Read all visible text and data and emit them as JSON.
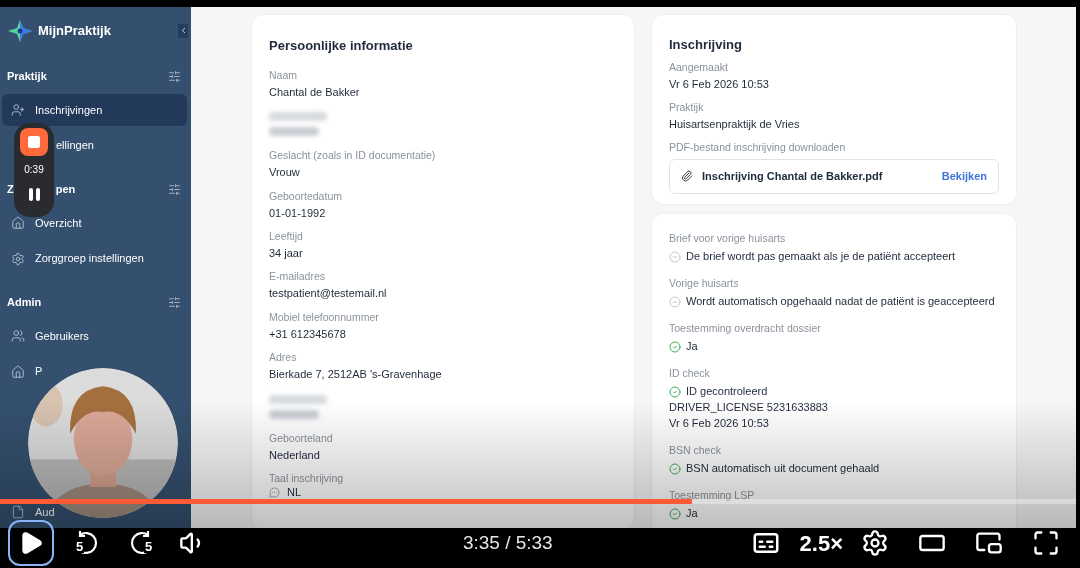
{
  "sidebar": {
    "brand": "MijnPraktijk",
    "sections": [
      {
        "title": "Praktijk",
        "items": [
          {
            "label": "Inschrijvingen",
            "selected": true
          },
          {
            "label": "ellingen",
            "selected": false
          }
        ]
      },
      {
        "title": "Z",
        "title_tail": "pen",
        "items": [
          {
            "label": "Overzicht",
            "selected": false
          },
          {
            "label": "Zorggroep instellingen",
            "selected": false
          }
        ]
      },
      {
        "title": "Admin",
        "items": [
          {
            "label": "Gebruikers",
            "selected": false
          },
          {
            "label": "P",
            "selected": false
          },
          {
            "label": "Aud",
            "selected": false
          }
        ]
      }
    ]
  },
  "recorder": {
    "time": "0:39"
  },
  "personal": {
    "title": "Persoonlijke informatie",
    "fields": [
      {
        "kind": "text",
        "label": "Naam",
        "value": "Chantal de Bakker"
      },
      {
        "kind": "redacted"
      },
      {
        "kind": "text",
        "label": "Geslacht (zoals in ID documentatie)",
        "value": "Vrouw"
      },
      {
        "kind": "text",
        "label": "Geboortedatum",
        "value": "01-01-1992"
      },
      {
        "kind": "text",
        "label": "Leeftijd",
        "value": "34 jaar"
      },
      {
        "kind": "text",
        "label": "E-mailadres",
        "value": "testpatient@testemail.nl"
      },
      {
        "kind": "text",
        "label": "Mobiel telefoonnummer",
        "value": "+31 612345678"
      },
      {
        "kind": "text",
        "label": "Adres",
        "value": "Bierkade 7, 2512AB 's-Gravenhage"
      },
      {
        "kind": "redacted"
      },
      {
        "kind": "text",
        "label": "Geboorteland",
        "value": "Nederland"
      },
      {
        "kind": "language",
        "label": "Taal inschrijving",
        "value": "NL"
      }
    ]
  },
  "registration": {
    "title": "Inschrijving",
    "fields": [
      {
        "label": "Aangemaakt",
        "value": "Vr 6 Feb 2026 10:53"
      },
      {
        "label": "Praktijk",
        "value": "Huisartsenpraktijk de Vries"
      }
    ],
    "pdf": {
      "label": "PDF-bestand inschrijving downloaden",
      "file": "Inschrijving Chantal de Bakker.pdf",
      "action": "Bekijken"
    }
  },
  "checks": [
    {
      "label": "Brief voor vorige huisarts",
      "done": false,
      "lines": [
        "De brief wordt pas gemaakt als je de patiënt accepteert"
      ]
    },
    {
      "label": "Vorige huisarts",
      "done": false,
      "lines": [
        "Wordt automatisch opgehaald nadat de patiënt is geaccepteerd"
      ]
    },
    {
      "label": "Toestemming overdracht dossier",
      "done": true,
      "lines": [
        "Ja"
      ]
    },
    {
      "label": "ID check",
      "done": true,
      "lines": [
        "ID gecontroleerd",
        "DRIVER_LICENSE 5231633883",
        "Vr 6 Feb 2026 10:53"
      ]
    },
    {
      "label": "BSN check",
      "done": true,
      "lines": [
        "BSN automatisch uit document gehaald"
      ]
    },
    {
      "label": "Toestemming LSP",
      "done": true,
      "lines": [
        "Ja"
      ]
    }
  ],
  "player": {
    "level": 0.643,
    "time": "3:35 / 5:33",
    "rewind": "5",
    "forward": "5",
    "speed": "2.5×"
  }
}
